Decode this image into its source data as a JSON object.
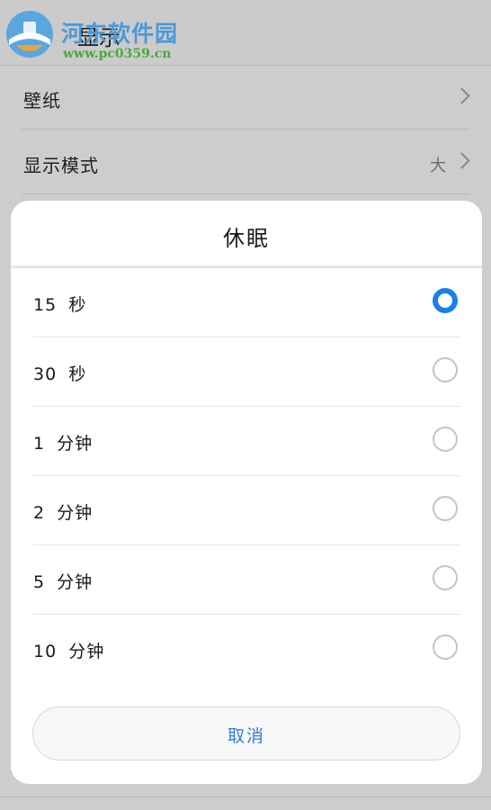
{
  "watermark": {
    "name": "河东软件园",
    "url": "www.pc0359.cn"
  },
  "background": {
    "title": "显示",
    "rows": [
      {
        "label": "壁纸",
        "value": ""
      },
      {
        "label": "显示模式",
        "value": "大"
      }
    ]
  },
  "dialog": {
    "title": "休眠",
    "options": [
      {
        "label": "15 秒",
        "selected": true
      },
      {
        "label": "30 秒",
        "selected": false
      },
      {
        "label": "1 分钟",
        "selected": false
      },
      {
        "label": "2 分钟",
        "selected": false
      },
      {
        "label": "5 分钟",
        "selected": false
      },
      {
        "label": "10 分钟",
        "selected": false
      }
    ],
    "cancel_label": "取消"
  },
  "colors": {
    "accent": "#1a7fe8",
    "cancel_text": "#2f7fd6",
    "watermark_name": "#4a9ad9",
    "watermark_url": "#4aa83a"
  },
  "icons": {
    "chevron": "chevron-right-icon",
    "radio_checked": "radio-checked-icon",
    "radio_unchecked": "radio-unchecked-icon",
    "watermark_logo": "watermark-logo-icon"
  }
}
